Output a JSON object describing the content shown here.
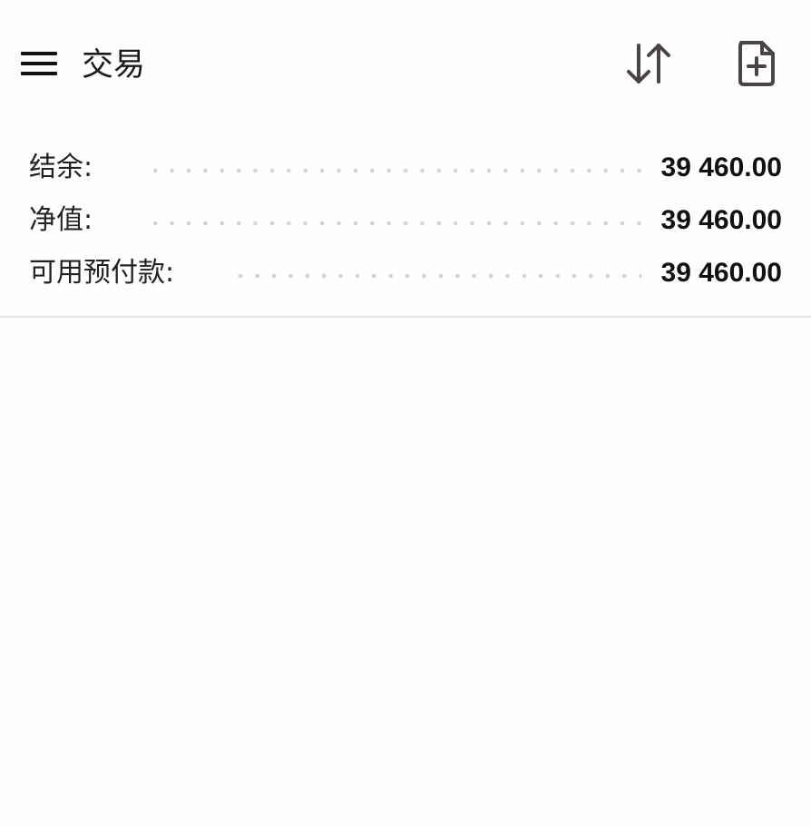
{
  "app_bar": {
    "title": "交易",
    "menu_icon": "hamburger-menu-icon",
    "sort_icon": "sort-arrows-icon",
    "new_order_icon": "file-plus-icon"
  },
  "account_summary": {
    "rows": [
      {
        "label": "结余:",
        "value": "39 460.00"
      },
      {
        "label": "净值:",
        "value": "39 460.00"
      },
      {
        "label": "可用预付款:",
        "value": "39 460.00"
      }
    ]
  },
  "colors": {
    "background": "#fefefe",
    "text": "#1c1c1c",
    "icon": "#4a4444",
    "dots": "#d2d2d2",
    "divider": "#e4e4e4"
  }
}
